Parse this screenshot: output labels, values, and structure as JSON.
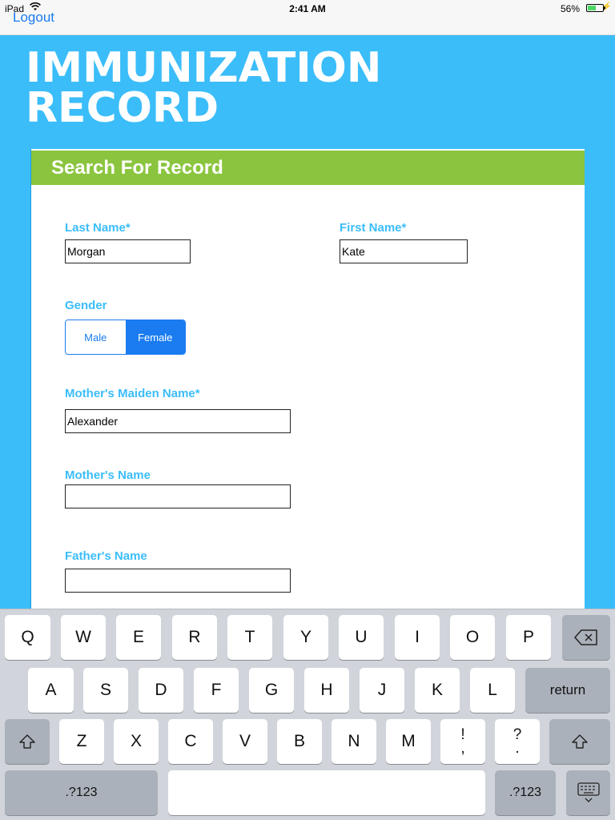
{
  "status": {
    "carrier": "iPad",
    "time": "2:41 AM",
    "battery": "56%",
    "battery_level": 0.56
  },
  "nav": {
    "logout": "Logout"
  },
  "title": {
    "line1": "IMMUNIZATION",
    "line2": "RECORD"
  },
  "card": {
    "heading": "Search For Record"
  },
  "form": {
    "last_name_label": "Last Name*",
    "last_name_value": "Morgan",
    "first_name_label": "First Name*",
    "first_name_value": "Kate",
    "gender_label": "Gender",
    "gender_options": [
      "Male",
      "Female"
    ],
    "gender_selected": "Female",
    "maiden_label": "Mother's Maiden Name*",
    "maiden_value": "Alexander",
    "mother_label": "Mother's Name",
    "mother_value": "",
    "father_label": "Father's Name",
    "father_value": ""
  },
  "keyboard": {
    "row1": [
      "Q",
      "W",
      "E",
      "R",
      "T",
      "Y",
      "U",
      "I",
      "O",
      "P"
    ],
    "row2": [
      "A",
      "S",
      "D",
      "F",
      "G",
      "H",
      "J",
      "K",
      "L"
    ],
    "row3": [
      "Z",
      "X",
      "C",
      "V",
      "B",
      "N",
      "M"
    ],
    "return": "return",
    "numbers": ".?123",
    "excl_top": "!",
    "excl_bot": ",",
    "quest_top": "?",
    "quest_bot": "."
  }
}
